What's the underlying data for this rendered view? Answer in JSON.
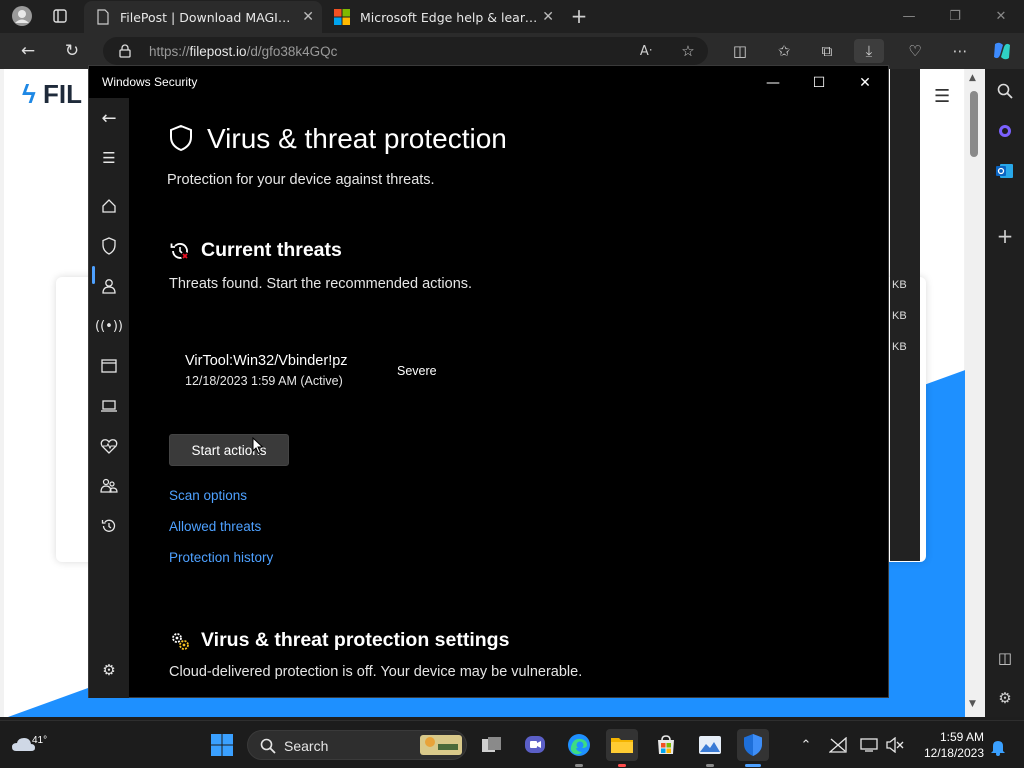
{
  "browser": {
    "tabs": [
      {
        "title": "FilePost | Download MAGIX_Vega",
        "active": true
      },
      {
        "title": "Microsoft Edge help & learning",
        "active": false
      }
    ],
    "url_prefix": "https://",
    "url_domain": "filepost.io",
    "url_path": "/d/gfo38k4GQc"
  },
  "page_behind": {
    "logo_text": "FIL",
    "size_labels": [
      "KB",
      "KB",
      "KB"
    ]
  },
  "security_window": {
    "title": "Windows Security",
    "page_title": "Virus & threat protection",
    "page_subtitle": "Protection for your device against threats.",
    "current_threats": {
      "heading": "Current threats",
      "description": "Threats found. Start the recommended actions.",
      "threat": {
        "name": "VirTool:Win32/Vbinder!pz",
        "datetime": "12/18/2023 1:59 AM (Active)",
        "severity": "Severe"
      },
      "start_button": "Start actions",
      "links": [
        "Scan options",
        "Allowed threats",
        "Protection history"
      ]
    },
    "settings": {
      "heading": "Virus & threat protection settings",
      "description": "Cloud-delivered protection is off. Your device may be vulnerable."
    },
    "nav_icons": [
      "back-icon",
      "menu-icon",
      "home-icon",
      "shield-icon",
      "account-icon",
      "firewall-icon",
      "app-browser-icon",
      "device-security-icon",
      "health-icon",
      "family-icon",
      "history-icon",
      "settings-icon"
    ],
    "selected_nav": "shield-icon"
  },
  "taskbar": {
    "weather_temp": "41°",
    "search_placeholder": "Search",
    "time": "1:59 AM",
    "date": "12/18/2023"
  },
  "colors": {
    "accent_link": "#4ea1ff",
    "window_bg": "#000000",
    "page_blue": "#1e90ff"
  }
}
